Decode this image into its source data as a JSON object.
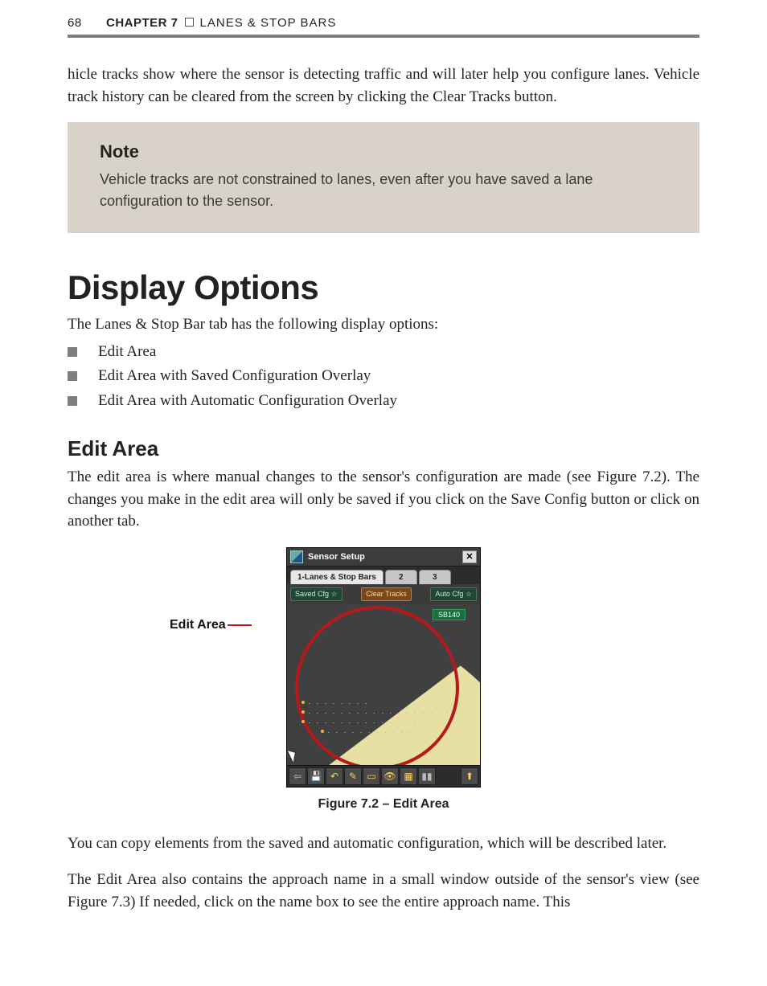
{
  "header": {
    "page_number": "68",
    "chapter_label": "CHAPTER 7",
    "chapter_title": "LANES & STOP BARS"
  },
  "intro_paragraph": "hicle tracks show where the sensor is detecting traffic and will later help you configure lanes. Vehicle track history can be cleared from the screen by clicking the Clear Tracks button.",
  "note": {
    "title": "Note",
    "text": "Vehicle tracks are not constrained to lanes, even after you have saved a lane configuration to the sensor."
  },
  "section_title": "Display Options",
  "section_intro": "The Lanes & Stop Bar tab has the following display options:",
  "bullets": [
    "Edit Area",
    "Edit Area with Saved Configuration Overlay",
    "Edit Area with Automatic Configuration Overlay"
  ],
  "subsection_title": "Edit Area",
  "subsection_p1": "The edit area is where manual changes to the sensor's configuration are made (see Figure 7.2). The changes you make in the edit area will only be saved if you click on the Save Config button or click on another tab.",
  "figure": {
    "pointer_label": "Edit Area",
    "window_title": "Sensor Setup",
    "tab_active": "1-Lanes & Stop Bars",
    "tab_2": "2",
    "tab_3": "3",
    "chip_saved": "Saved Cfg ☆",
    "chip_clear": "Clear Tracks",
    "chip_auto": "Auto Cfg ☆",
    "badge": "SB140",
    "toolbar_icons": [
      "⇦",
      "💾",
      "↶",
      "✎",
      "▭",
      "👁",
      "▦",
      "▮▮",
      "⬆"
    ],
    "caption": "Figure 7.2 – Edit Area"
  },
  "after_p1": "You can copy elements from the saved and automatic configuration, which will be described later.",
  "after_p2": "The Edit Area also contains the approach name in a small window outside of the sensor's view (see Figure 7.3) If needed, click on the name box to see the entire approach name. This"
}
